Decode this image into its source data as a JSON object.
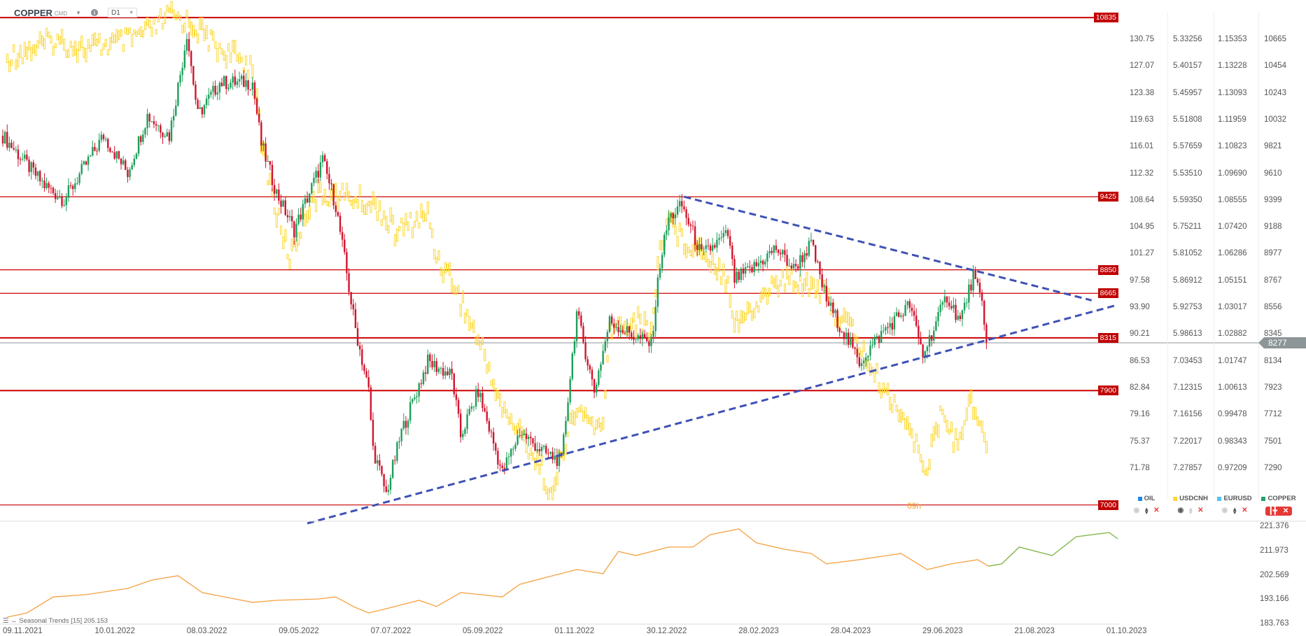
{
  "header": {
    "symbol": "COPPER",
    "market": "CMD",
    "timeframe": "D1",
    "info_icon": "info-icon",
    "caret_icon": "chevron-down-icon"
  },
  "axes": {
    "oil": [
      "130.75",
      "127.07",
      "123.38",
      "119.63",
      "116.01",
      "112.32",
      "108.64",
      "104.95",
      "101.27",
      "97.58",
      "93.90",
      "90.21",
      "86.53",
      "82.84",
      "79.16",
      "75.37",
      "71.78"
    ],
    "usdcnh": [
      "5.33256",
      "5.40157",
      "5.45957",
      "5.51808",
      "5.57659",
      "5.53510",
      "5.59350",
      "5.75211",
      "5.81052",
      "5.86912",
      "5.92753",
      "5.98613",
      "7.03453",
      "7.12315",
      "7.16156",
      "7.22017",
      "7.27857"
    ],
    "eurusd": [
      "1.15353",
      "1.13228",
      "1.13093",
      "1.11959",
      "1.10823",
      "1.09690",
      "1.08555",
      "1.07420",
      "1.06286",
      "1.05151",
      "1.03017",
      "1.02882",
      "1.01747",
      "1.00613",
      "0.99478",
      "0.98343",
      "0.97209"
    ],
    "copper": [
      "10665",
      "10454",
      "10243",
      "10032",
      "9821",
      "9610",
      "9399",
      "9188",
      "8977",
      "8767",
      "8556",
      "8345",
      "8134",
      "7923",
      "7712",
      "7501",
      "7290"
    ]
  },
  "levels": [
    "10835",
    "9425",
    "8850",
    "8665",
    "8315",
    "7900",
    "7000"
  ],
  "current_price": "8277",
  "countdown": "09h",
  "legend": [
    {
      "name": "OIL",
      "color": "#1e88e5"
    },
    {
      "name": "USDCNH",
      "color": "#fdd835"
    },
    {
      "name": "EURUSD",
      "color": "#4fc3f7"
    },
    {
      "name": "COPPER",
      "color": "#26a269"
    }
  ],
  "lower_axis": [
    "221.376",
    "211.973",
    "202.569",
    "193.166",
    "183.763"
  ],
  "indicator": {
    "label": "Seasonal Trends",
    "period": "[15]",
    "value": "205.153"
  },
  "dates": [
    "09.11.2021",
    "10.01.2022",
    "08.03.2022",
    "09.05.2022",
    "07.07.2022",
    "05.09.2022",
    "01.11.2022",
    "30.12.2022",
    "28.02.2023",
    "28.04.2023",
    "29.06.2023",
    "21.08.2023",
    "01.10.2023"
  ],
  "colors": {
    "up": "#1e9e5a",
    "down": "#d0142c",
    "level": "#cc0000",
    "trend": "#3f51b5",
    "usdcnh": "#fdd835",
    "seasonal": "#f5a142",
    "seasonal_proj": "#7cb342"
  },
  "chart_data": {
    "type": "candlestick",
    "title": "COPPER CMD D1",
    "x_unit": "trading day index (0 = 09.11.2021, 42 days per date label)",
    "copper_ylim": [
      7290,
      10665
    ],
    "copper_waypoints": [
      [
        0,
        9905
      ],
      [
        19,
        9514
      ],
      [
        28,
        9400
      ],
      [
        46,
        9905
      ],
      [
        57,
        9613
      ],
      [
        66,
        10065
      ],
      [
        76,
        9905
      ],
      [
        82,
        10489
      ],
      [
        84,
        10715
      ],
      [
        89,
        10065
      ],
      [
        99,
        10324
      ],
      [
        114,
        10324
      ],
      [
        118,
        9840
      ],
      [
        125,
        9454
      ],
      [
        133,
        9162
      ],
      [
        146,
        9712
      ],
      [
        152,
        9355
      ],
      [
        156,
        8936
      ],
      [
        158,
        8705
      ],
      [
        161,
        8385
      ],
      [
        167,
        7896
      ],
      [
        169,
        7444
      ],
      [
        175,
        7087
      ],
      [
        182,
        7576
      ],
      [
        194,
        8127
      ],
      [
        205,
        8017
      ],
      [
        209,
        7543
      ],
      [
        217,
        7896
      ],
      [
        228,
        7251
      ],
      [
        236,
        7576
      ],
      [
        247,
        7411
      ],
      [
        255,
        7345
      ],
      [
        262,
        8512
      ],
      [
        270,
        7896
      ],
      [
        277,
        8446
      ],
      [
        289,
        8320
      ],
      [
        296,
        8265
      ],
      [
        300,
        8903
      ],
      [
        304,
        9255
      ],
      [
        310,
        9355
      ],
      [
        319,
        8964
      ],
      [
        331,
        9129
      ],
      [
        334,
        8771
      ],
      [
        342,
        8855
      ],
      [
        353,
        9022
      ],
      [
        361,
        8855
      ],
      [
        369,
        9055
      ],
      [
        376,
        8611
      ],
      [
        388,
        8220
      ],
      [
        391,
        8127
      ],
      [
        403,
        8385
      ],
      [
        414,
        8576
      ],
      [
        420,
        8180
      ],
      [
        431,
        8644
      ],
      [
        437,
        8446
      ],
      [
        443,
        8804
      ],
      [
        447,
        8576
      ],
      [
        449,
        8277
      ]
    ],
    "usdcnh_waypoints": [
      [
        2,
        6.37
      ],
      [
        23,
        6.33
      ],
      [
        38,
        6.35
      ],
      [
        57,
        6.33
      ],
      [
        70,
        6.3
      ],
      [
        76,
        6.27
      ],
      [
        86,
        6.29
      ],
      [
        99,
        6.35
      ],
      [
        114,
        6.39
      ],
      [
        118,
        6.57
      ],
      [
        125,
        6.74
      ],
      [
        131,
        6.84
      ],
      [
        141,
        6.7
      ],
      [
        152,
        6.69
      ],
      [
        171,
        6.72
      ],
      [
        179,
        6.78
      ],
      [
        194,
        6.74
      ],
      [
        198,
        6.84
      ],
      [
        205,
        6.89
      ],
      [
        213,
        6.99
      ],
      [
        220,
        7.07
      ],
      [
        228,
        7.2
      ],
      [
        236,
        7.25
      ],
      [
        247,
        7.35
      ],
      [
        251,
        7.41
      ],
      [
        255,
        7.3
      ],
      [
        262,
        7.2
      ],
      [
        274,
        7.25
      ],
      [
        277,
        7.01
      ],
      [
        289,
        6.99
      ],
      [
        296,
        7.01
      ],
      [
        300,
        6.82
      ],
      [
        304,
        6.74
      ],
      [
        310,
        6.8
      ],
      [
        319,
        6.82
      ],
      [
        331,
        6.89
      ],
      [
        334,
        6.99
      ],
      [
        342,
        6.97
      ],
      [
        350,
        6.91
      ],
      [
        361,
        6.89
      ],
      [
        372,
        6.91
      ],
      [
        380,
        6.97
      ],
      [
        388,
        7.01
      ],
      [
        395,
        7.09
      ],
      [
        403,
        7.16
      ],
      [
        410,
        7.2
      ],
      [
        418,
        7.3
      ],
      [
        422,
        7.33
      ],
      [
        429,
        7.2
      ],
      [
        435,
        7.28
      ],
      [
        441,
        7.18
      ],
      [
        447,
        7.23
      ],
      [
        449,
        7.3
      ]
    ],
    "seasonal_waypoints": [
      [
        2,
        186.2
      ],
      [
        11,
        187.8
      ],
      [
        23,
        194.0
      ],
      [
        38,
        194.9
      ],
      [
        57,
        197.3
      ],
      [
        68,
        200.5
      ],
      [
        80,
        202.2
      ],
      [
        91,
        195.7
      ],
      [
        106,
        193.2
      ],
      [
        114,
        191.9
      ],
      [
        125,
        192.7
      ],
      [
        144,
        193.2
      ],
      [
        152,
        194.0
      ],
      [
        160,
        190.3
      ],
      [
        167,
        187.8
      ],
      [
        179,
        190.3
      ],
      [
        190,
        192.7
      ],
      [
        198,
        190.3
      ],
      [
        209,
        195.7
      ],
      [
        228,
        194.0
      ],
      [
        236,
        198.9
      ],
      [
        251,
        202.2
      ],
      [
        262,
        204.6
      ],
      [
        274,
        203.0
      ],
      [
        281,
        211.6
      ],
      [
        289,
        210.0
      ],
      [
        304,
        213.3
      ],
      [
        315,
        213.3
      ],
      [
        323,
        218.1
      ],
      [
        336,
        220.3
      ],
      [
        344,
        214.9
      ],
      [
        357,
        212.4
      ],
      [
        369,
        210.8
      ],
      [
        376,
        206.8
      ],
      [
        391,
        208.4
      ],
      [
        410,
        210.8
      ],
      [
        422,
        204.6
      ],
      [
        433,
        206.8
      ],
      [
        445,
        208.4
      ],
      [
        450,
        205.9
      ]
    ],
    "seasonal_projection": [
      [
        450,
        205.9
      ],
      [
        456,
        206.8
      ],
      [
        464,
        213.3
      ],
      [
        479,
        210.0
      ],
      [
        490,
        217.3
      ],
      [
        505,
        218.9
      ],
      [
        509,
        216.5
      ]
    ],
    "levels": [
      10835,
      9425,
      8850,
      8665,
      8315,
      7900,
      7000
    ],
    "trendlines": [
      {
        "name": "upper",
        "from": [
          311,
          9425
        ],
        "to": [
          497,
          8610
        ]
      },
      {
        "name": "lower",
        "from": [
          139,
          6855
        ],
        "to": [
          508,
          8570
        ]
      }
    ],
    "lower_ylim": [
      183.763,
      221.376
    ]
  }
}
